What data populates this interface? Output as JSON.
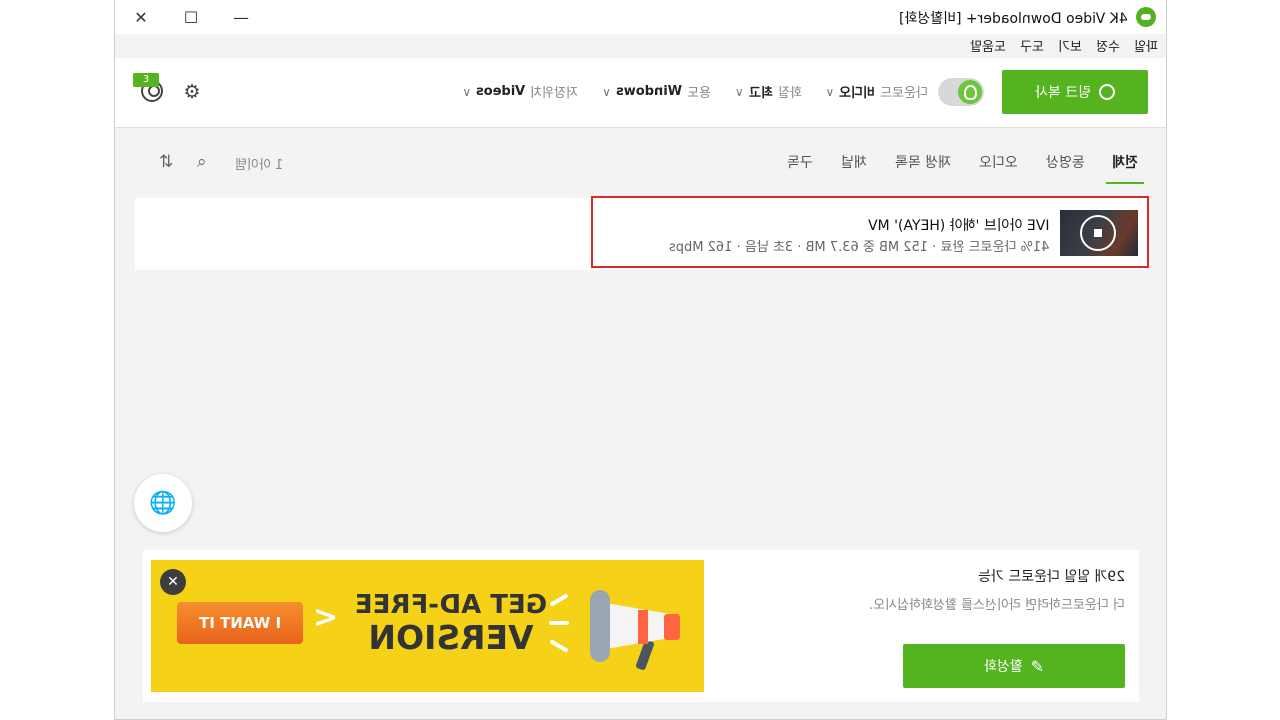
{
  "window": {
    "title": "4K Video Downloader+ [비활성화]",
    "controls": {
      "close": "✕",
      "maximize": "☐",
      "minimize": "—"
    }
  },
  "menu": [
    "파일",
    "수정",
    "보기",
    "도구",
    "도움말"
  ],
  "toolbar": {
    "paste_link": "링크 복사",
    "smart_mode_on": true,
    "options": [
      {
        "label": "다운로드",
        "value": "비디오"
      },
      {
        "label": "화질",
        "value": "최고"
      },
      {
        "label": "용도",
        "value": "Windows"
      },
      {
        "label": "저장위치",
        "value": "Videos"
      }
    ],
    "account_badge": "3"
  },
  "tabs": {
    "items": [
      "전체",
      "동영상",
      "오디오",
      "재생 목록",
      "채널",
      "구독"
    ],
    "active": "전체"
  },
  "list": {
    "count_label": "1 아이템",
    "items": [
      {
        "title": "IVE 아이브 '해야 (HEYA)' MV",
        "status": "41% 다운로드 완료 · 152 MB 중 63.7 MB · 3초 남음 · 162 Mbps",
        "progress_percent": 41
      }
    ]
  },
  "ad": {
    "close": "✕",
    "cta": "I WANT IT",
    "headline_1": "GET AD-FREE",
    "headline_2": "VERSION",
    "colors": {
      "background": "#f5d218",
      "button": "#f07a25"
    }
  },
  "promo": {
    "title": "29개 일일 다운로드 가능",
    "description": "더 다운로드하려면 라이선스를 활성화하십시오.",
    "activate": "활성화"
  },
  "colors": {
    "accent": "#56b320",
    "highlight_border": "#d72b2b"
  }
}
